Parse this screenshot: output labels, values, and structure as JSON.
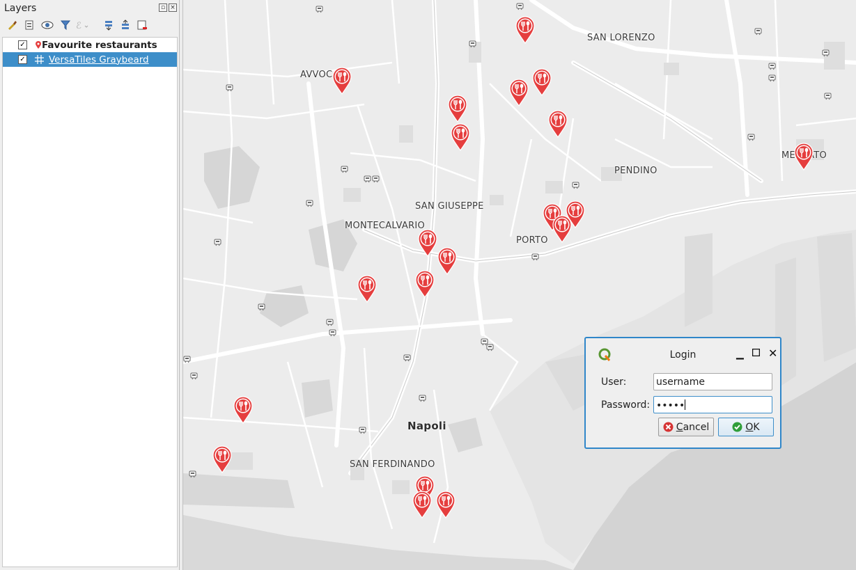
{
  "layers_panel": {
    "title": "Layers",
    "toolbar_icons": [
      "style-manager-icon",
      "add-group-icon",
      "visibility-icon",
      "filter-legend-icon",
      "filter-expression-icon",
      "expand-all-icon",
      "collapse-all-icon",
      "remove-layer-icon"
    ],
    "layers": [
      {
        "name": "Favourite restaurants",
        "checked": true,
        "type": "vector-point",
        "selected": false
      },
      {
        "name": "VersaTiles Graybeard",
        "checked": true,
        "type": "vector-tile",
        "selected": true
      }
    ]
  },
  "map": {
    "places": {
      "san_lorenzo": "SAN LORENZO",
      "avvocata": "AVVOCATA",
      "mercato": "MERCATO",
      "pendino": "PENDINO",
      "san_giuseppe": "SAN GIUSEPPE",
      "montecalvario": "MONTECALVARIO",
      "porto": "PORTO",
      "napoli": "Napoli",
      "san_ferdinando": "SAN FERDINANDO"
    },
    "marker_symbol": "restaurant-pin-icon",
    "marker_color": "#e53e3e",
    "land_color": "#ececec",
    "water_color": "#d3d3d3"
  },
  "login_dialog": {
    "title": "Login",
    "user_label": "User:",
    "user_value": "username",
    "password_label": "Password:",
    "password_value": "•••••",
    "cancel_label_pre": "",
    "cancel_label_key": "C",
    "cancel_label_post": "ancel",
    "ok_label_key": "O",
    "ok_label_post": "K",
    "accent_color": "#2f86c9"
  }
}
